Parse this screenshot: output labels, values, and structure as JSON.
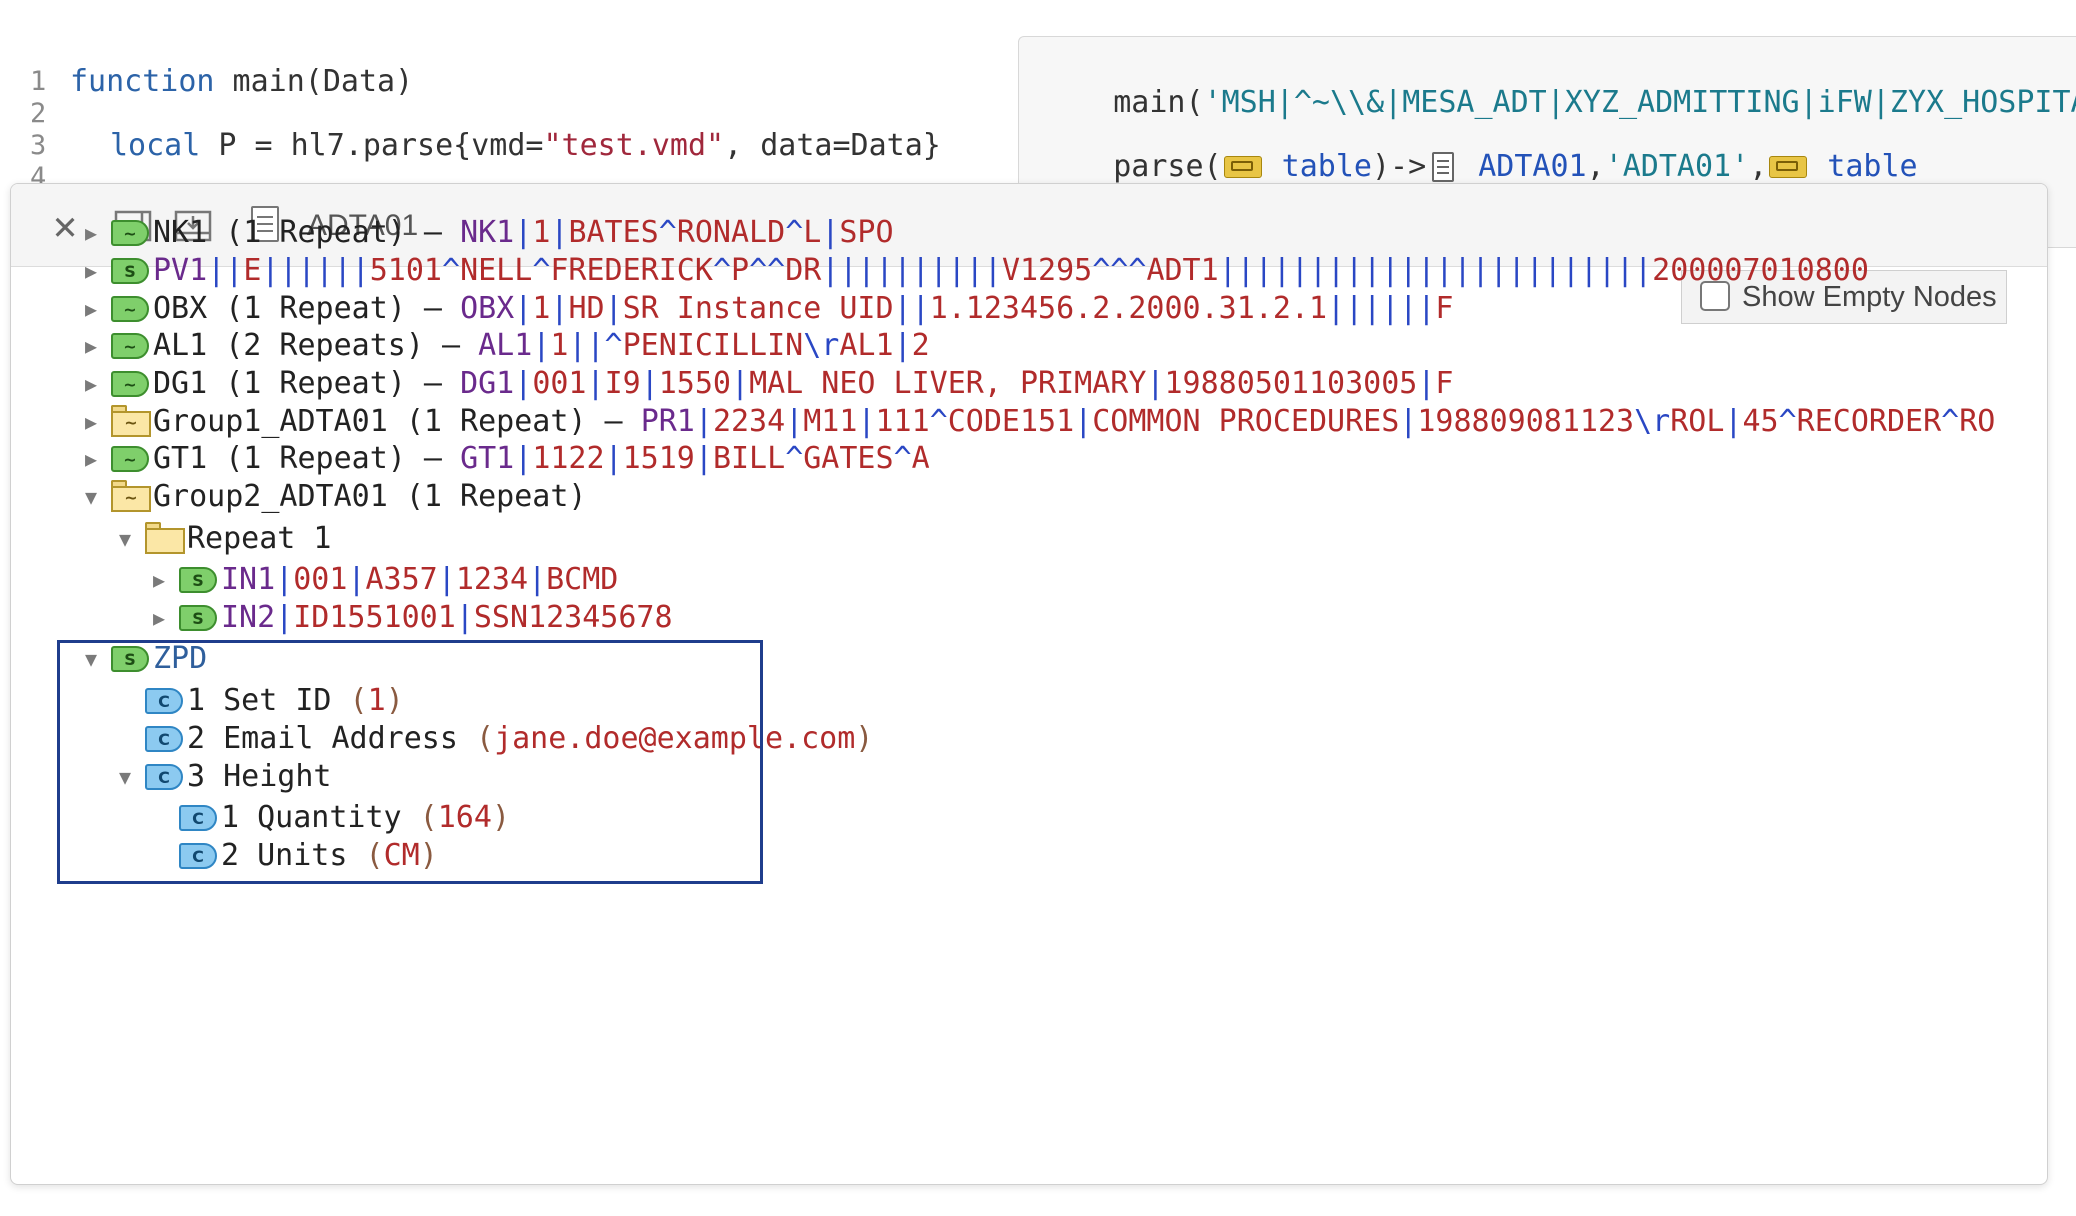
{
  "editor": {
    "lines": [
      {
        "num": "1",
        "keyword": "function",
        "rest": " main(Data)"
      },
      {
        "num": "2",
        "keyword": "",
        "rest": ""
      },
      {
        "num": "3",
        "keyword": "local",
        "rest_a": " P = hl7.parse{vmd=",
        "str": "\"test.vmd\"",
        "rest_b": ", data=Data}"
      },
      {
        "num": "4"
      }
    ]
  },
  "annotation": {
    "line1_prefix": "main(",
    "line1_value": "'MSH|^~\\\\&|MESA_ADT|XYZ_ADMITTING|iFW|ZYX_HOSPITAL||",
    "line2_parse": "parse(",
    "line2_table1": " table",
    "line2_arrow": ")->",
    "line2_adta": " ADTA01",
    "line2_comma": ",",
    "line2_str": "'ADTA01'",
    "line2_comma2": ",",
    "line2_table2": " table"
  },
  "popup": {
    "title": "ADTA01",
    "show_empty_label": "Show Empty Nodes",
    "rows": [
      {
        "kind": "repeat",
        "name": "NK1",
        "count": " (1 Repeat) – ",
        "seg": "NK1",
        "fields": [
          [
            "|",
            "1"
          ],
          [
            "|",
            "BATES"
          ],
          [
            "^",
            "RONALD"
          ],
          [
            "^",
            "L"
          ],
          [
            "|",
            "SPO"
          ]
        ]
      },
      {
        "kind": "segment",
        "seg": "PV1",
        "fields": [
          [
            "||",
            "E"
          ],
          [
            "||||||",
            "5101"
          ],
          [
            "^",
            "NELL"
          ],
          [
            "^",
            "FREDERICK"
          ],
          [
            "^",
            "P"
          ],
          [
            "^^",
            "DR"
          ],
          [
            "||||||||||",
            "V1295"
          ],
          [
            "^^^",
            "ADT1"
          ],
          [
            "||||||||||||||||||||||||",
            "200007010800"
          ]
        ]
      },
      {
        "kind": "repeat",
        "name": "OBX",
        "count": " (1 Repeat) – ",
        "seg": "OBX",
        "fields": [
          [
            "|",
            "1"
          ],
          [
            "|",
            "HD"
          ],
          [
            "|",
            "SR Instance UID"
          ],
          [
            "||",
            "1.123456.2.2000.31.2.1"
          ],
          [
            "||||||",
            "F"
          ]
        ]
      },
      {
        "kind": "repeat",
        "name": "AL1",
        "count": " (2 Repeats) – ",
        "seg": "AL1",
        "fields": [
          [
            "|",
            "1"
          ],
          [
            "||^",
            "PENICILLIN"
          ],
          [
            "\\r",
            "AL1"
          ],
          [
            "|",
            "2"
          ]
        ]
      },
      {
        "kind": "repeat",
        "name": "DG1",
        "count": " (1 Repeat) – ",
        "seg": "DG1",
        "fields": [
          [
            "|",
            "001"
          ],
          [
            "|",
            "I9"
          ],
          [
            "|",
            "1550"
          ],
          [
            "|",
            "MAL NEO LIVER, PRIMARY"
          ],
          [
            "|",
            "19880501103005"
          ],
          [
            "|",
            "F"
          ]
        ]
      },
      {
        "kind": "group",
        "name": "Group1_ADTA01",
        "count": " (1 Repeat) – ",
        "seg": "PR1",
        "fields": [
          [
            "|",
            "2234"
          ],
          [
            "|",
            "M11"
          ],
          [
            "|",
            "111"
          ],
          [
            "^",
            "CODE151"
          ],
          [
            "|",
            "COMMON PROCEDURES"
          ],
          [
            "|",
            "198809081123"
          ],
          [
            "\\r",
            "ROL"
          ],
          [
            "|",
            "45"
          ],
          [
            "^",
            "RECORDER"
          ],
          [
            "^",
            "RO"
          ]
        ]
      },
      {
        "kind": "repeat",
        "name": "GT1",
        "count": " (1 Repeat) – ",
        "seg": "GT1",
        "fields": [
          [
            "|",
            "1122"
          ],
          [
            "|",
            "1519"
          ],
          [
            "|",
            "BILL"
          ],
          [
            "^",
            "GATES"
          ],
          [
            "^",
            "A"
          ]
        ]
      },
      {
        "kind": "groupopen",
        "name": "Group2_ADTA01",
        "count": " (1 Repeat)"
      },
      {
        "kind": "folder",
        "name": "Repeat 1"
      },
      {
        "kind": "segment",
        "seg": "IN1",
        "fields": [
          [
            "|",
            "001"
          ],
          [
            "|",
            "A357"
          ],
          [
            "|",
            "1234"
          ],
          [
            "|",
            "BCMD"
          ]
        ]
      },
      {
        "kind": "segment",
        "seg": "IN2",
        "fields": [
          [
            "|",
            "ID1551001"
          ],
          [
            "|",
            "SSN12345678"
          ]
        ]
      },
      {
        "kind": "zpd",
        "name": "ZPD"
      },
      {
        "kind": "field",
        "label": "1 Set ID",
        "value": "1"
      },
      {
        "kind": "field",
        "label": "2 Email Address",
        "value": "jane.doe@example.com"
      },
      {
        "kind": "field",
        "label": "3 Height",
        "value": ""
      },
      {
        "kind": "field",
        "label": "1 Quantity",
        "value": "164"
      },
      {
        "kind": "field",
        "label": "2 Units",
        "value": "CM"
      }
    ]
  },
  "icons": {
    "green_tag_repeat": "~",
    "green_tag_segment": "S",
    "blue_tag_component": "C",
    "folder_repeat": "~",
    "arrow_right": "▶",
    "arrow_down": "▼",
    "close": "✕"
  }
}
